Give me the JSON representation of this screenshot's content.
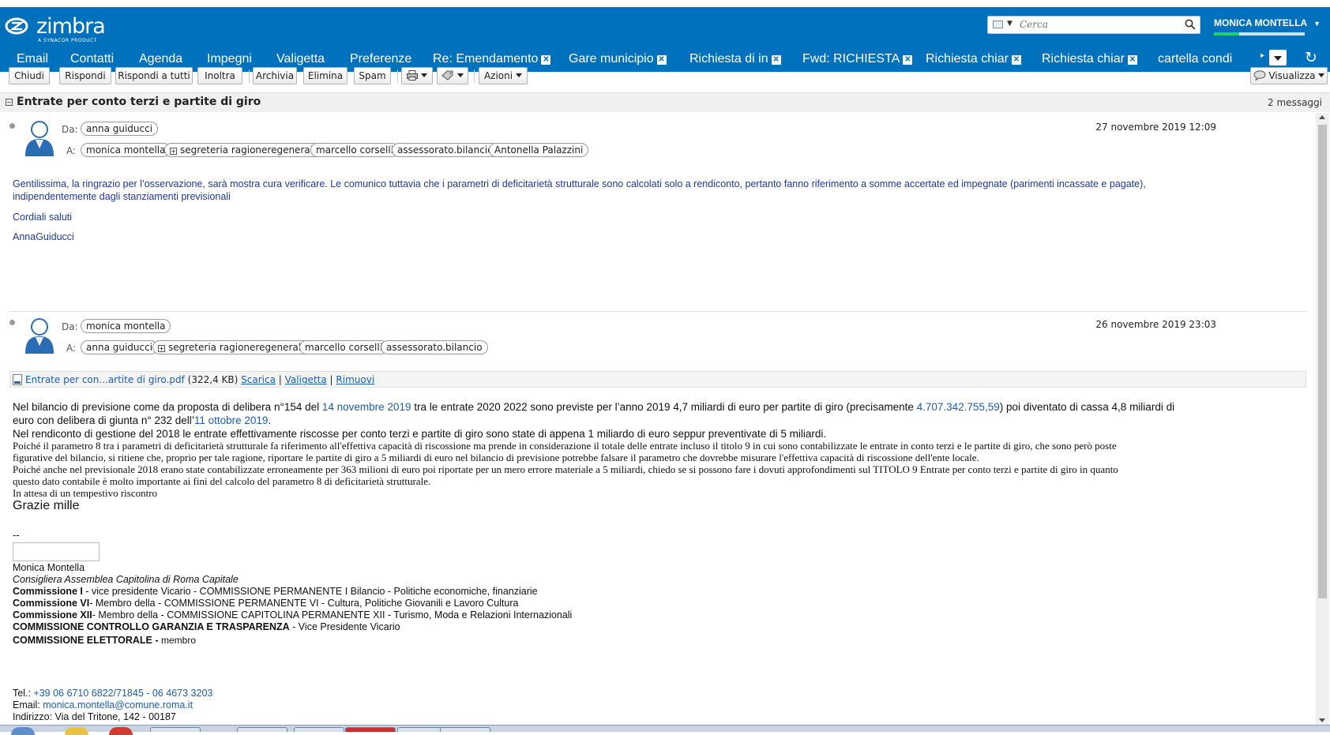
{
  "app": {
    "logo_text": "zimbra",
    "logo_sub": "A SYNACOR PRODUCT",
    "search_placeholder": "Cerca",
    "user_name": "MONICA MONTELLA"
  },
  "nav_tabs": [
    {
      "label": "Email",
      "closable": false
    },
    {
      "label": "Contatti",
      "closable": false
    },
    {
      "label": "Agenda",
      "closable": false
    },
    {
      "label": "Impegni",
      "closable": false
    },
    {
      "label": "Valigetta",
      "closable": false
    },
    {
      "label": "Preferenze",
      "closable": false
    },
    {
      "label": "Re: Emendamento",
      "closable": true
    },
    {
      "label": "Gare municipio",
      "closable": true
    },
    {
      "label": "Richiesta di in",
      "closable": true
    },
    {
      "label": "Fwd: RICHIESTA",
      "closable": true
    },
    {
      "label": "Richiesta chiar",
      "closable": true
    },
    {
      "label": "Richiesta chiar",
      "closable": true
    },
    {
      "label": "cartella condi",
      "closable": false
    }
  ],
  "toolbar": {
    "close": "Chiudi",
    "reply": "Rispondi",
    "reply_all": "Rispondi a tutti",
    "forward": "Inoltra",
    "archive": "Archivia",
    "delete": "Elimina",
    "spam": "Spam",
    "actions": "Azioni",
    "view": "Visualizza"
  },
  "conversation": {
    "subject": "Entrate per conto terzi e partite di giro",
    "count": "2 messaggi"
  },
  "messages": [
    {
      "from_label": "Da:",
      "to_label": "A:",
      "from": "anna guiducci",
      "to": [
        "monica montella",
        "segreteria ragioneregenerale",
        "marcello corselli",
        "assessorato.bilancio",
        "Antonella Palazzini"
      ],
      "to_group": [
        false,
        true,
        false,
        false,
        false
      ],
      "date": "27 novembre 2019 12:09",
      "body_line1": "Gentilissima, la ringrazio per l’osservazione, sarà mostra cura verificare. Le comunico tuttavia che i parametri di deficitarietà strutturale sono calcolati solo a rendiconto, pertanto fanno riferimento a somme accertate ed impegnate (parimenti incassate e pagate),",
      "body_line2": "indipendentemente dagli stanziamenti previsionali",
      "greeting": "Cordiali saluti",
      "signature": "AnnaGuiducci"
    },
    {
      "from_label": "Da:",
      "to_label": "A:",
      "from": "monica montella",
      "to": [
        "anna guiducci",
        "segreteria ragioneregenerale",
        "marcello corselli",
        "assessorato.bilancio"
      ],
      "to_group": [
        false,
        true,
        false,
        false
      ],
      "date": "26 novembre 2019 23:03",
      "attachment": {
        "name": "Entrate per con...artite di giro.pdf",
        "size": "(322,4 KB)",
        "download": "Scarica",
        "briefcase": "Valigetta",
        "remove": "Rimuovi",
        "sep": "|"
      },
      "p1_a": "Nel bilancio di previsione come da proposta di delibera n°154 del ",
      "p1_link1": "14 novembre 2019",
      "p1_b": " tra le entrate 2020 2022 sono previste per l’anno 2019 4,7 miliardi di euro per partite di giro (precisamente ",
      "p1_link2": "4.707.342.755,59",
      "p1_c": ") poi diventato di cassa 4,8 miliardi di",
      "p1_d": "euro con delibera di giunta n° 232 dell’",
      "p1_link3": "11 ottobre 2019",
      "p1_e": ".",
      "p2": "Nel rendiconto di gestione del 2018 le entrate effettivamente riscosse per conto terzi e partite di giro sono state di appena 1 miliardo di euro seppur preventivate di 5 miliardi.",
      "p3_l1": "Poiché il parametro 8 tra i parametri di deficitarietà strutturale fa riferimento all'effettiva capacità di riscossione ma prende in considerazione il totale delle entrate incluso il titolo 9 in cui sono contabilizzate le entrate in conto terzi e le partite di giro, che sono però poste",
      "p3_l2": "figurative del bilancio, si ritiene che, proprio per tale ragione, riportare le partite di giro a 5 miliardi di euro nel bilancio di previsione potrebbe falsare il parametro che dovrebbe misurare l'effettiva capacità di riscossione dell'ente locale.",
      "p4_l1": "Poiché anche nel previsionale 2018 erano state contabilizzate erroneamente per 363 milioni di euro poi riportate per un mero errore materiale a 5 miliardi, chiedo se si possono fare i dovuti approfondimenti sul TITOLO 9 Entrate per conto terzi e partite di giro in quanto",
      "p4_l2": "questo dato contabile è molto importante ai fini del calcolo del parametro 8 di deficitarietà strutturale.",
      "p5": "In attesa di un tempestivo riscontro",
      "thanks": "Grazie mille",
      "dashes": "--",
      "sig_name": "Monica Montella",
      "sig_role": "Consigliera Assemblea Capitolina di Roma Capitale",
      "sig_c1_b": "Commissione I",
      "sig_c1_t": " - vice presidente Vicario - COMMISSIONE PERMANENTE I Bilancio - Politiche economiche, finanziarie",
      "sig_c2_b": "Commissione VI",
      "sig_c2_t": "- Membro della - COMMISSIONE PERMANENTE VI - Cultura, Politiche Giovanili e Lavoro Cultura",
      "sig_c3_b": "Commissione XII",
      "sig_c3_t": "- Membro della - COMMISSIONE CAPITOLINA PERMANENTE XII - Turismo, Moda e Relazioni Internazionali",
      "sig_c4_b": "COMMISSIONE CONTROLLO GARANZIA E TRASPARENZA",
      "sig_c4_t": " - Vice Presidente Vicario",
      "sig_c5_b": "COMMISSIONE ELETTORALE - ",
      "sig_c5_t": "membro",
      "tel_label": "Tel.: ",
      "tel": "+39 06 6710 6822/71845 - 06 4673 3203",
      "email_label": "Email: ",
      "email": "monica.montella@comune.roma.it",
      "address": "Indirizzo: Via del Tritone, 142 - 00187"
    }
  ],
  "colors": {
    "header_blue": "#0071bc",
    "link_blue": "#1a5eb0",
    "body_blue": "#1f3a93"
  }
}
